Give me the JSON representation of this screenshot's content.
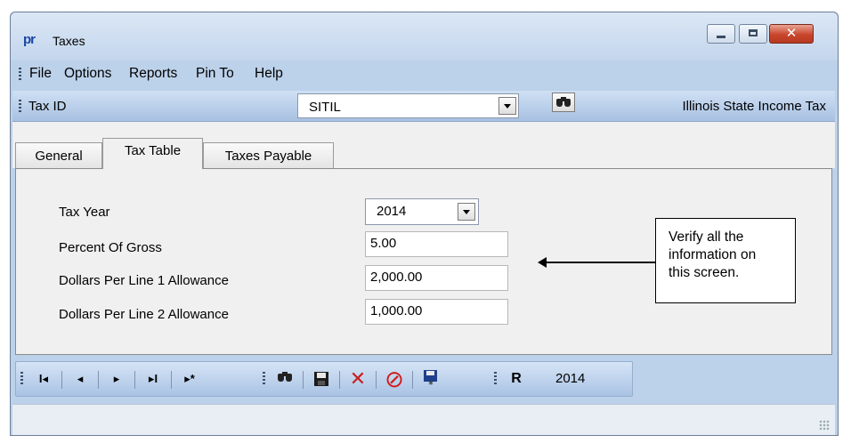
{
  "window": {
    "title": "Taxes",
    "app_icon_text": "pr",
    "close_glyph": "✕"
  },
  "menu": {
    "items": [
      "File",
      "Options",
      "Reports",
      "Pin To",
      "Help"
    ]
  },
  "tax_id_bar": {
    "label": "Tax ID",
    "value": "SITIL",
    "description": "Illinois State Income Tax"
  },
  "tabs": [
    {
      "label": "General",
      "active": false
    },
    {
      "label": "Tax Table",
      "active": true
    },
    {
      "label": "Taxes Payable",
      "active": false
    }
  ],
  "form": {
    "tax_year_label": "Tax Year",
    "tax_year_value": "2014",
    "percent_gross_label": "Percent Of Gross",
    "percent_gross_value": "5.00",
    "line1_label": "Dollars Per Line 1 Allowance",
    "line1_value": "2,000.00",
    "line2_label": "Dollars Per Line 2 Allowance",
    "line2_value": "1,000.00"
  },
  "callout": {
    "line1": "Verify all the",
    "line2": "information on",
    "line3": "this screen."
  },
  "toolbar": {
    "first_glyph": "I◂",
    "prev_glyph": "◂",
    "next_glyph": "▸",
    "last_glyph": "▸I",
    "new_glyph": "▸*",
    "delete_glyph": "✕",
    "cancel_glyph": "⊘",
    "report_glyph": "R",
    "year": "2014"
  },
  "colors": {
    "frame": "#bcd1ea",
    "delete_red": "#c81e1e",
    "cancel_red": "#d11a1a",
    "accent_blue": "#1a46a8"
  }
}
